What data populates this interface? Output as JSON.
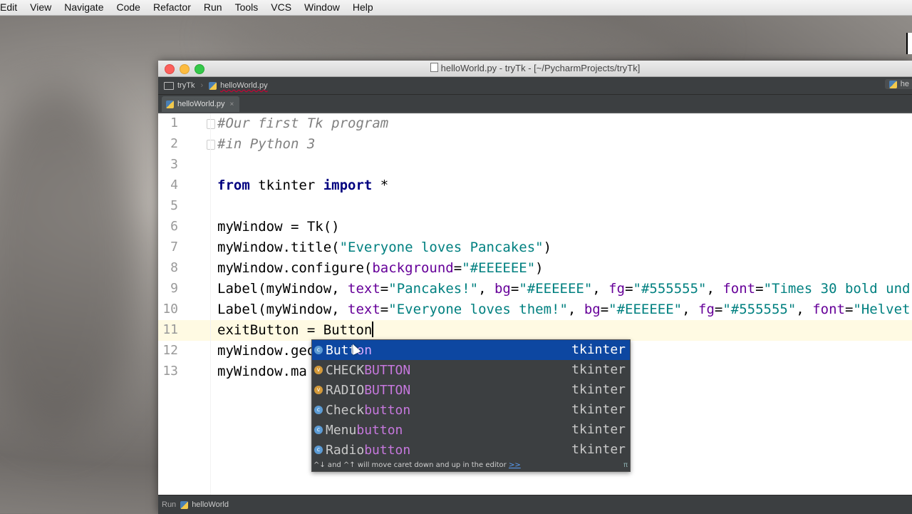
{
  "menubar": {
    "items": [
      "Edit",
      "View",
      "Navigate",
      "Code",
      "Refactor",
      "Run",
      "Tools",
      "VCS",
      "Window",
      "Help"
    ]
  },
  "window": {
    "title": "helloWorld.py - tryTk - [~/PycharmProjects/tryTk]"
  },
  "navbar": {
    "project": "tryTk",
    "file": "helloWorld.py",
    "right_label": "he"
  },
  "tabs": [
    {
      "label": "helloWorld.py",
      "close": "×"
    }
  ],
  "editor": {
    "line_numbers": [
      "1",
      "2",
      "3",
      "4",
      "5",
      "6",
      "7",
      "8",
      "9",
      "10",
      "11",
      "12",
      "13"
    ],
    "lines": {
      "l1": "#Our first Tk program",
      "l2": "#in Python 3",
      "l4_from": "from",
      "l4_mid": " tkinter ",
      "l4_import": "import",
      "l4_end": " *",
      "l6": "myWindow = Tk()",
      "l7_a": "myWindow.title(",
      "l7_s": "\"Everyone loves Pancakes\"",
      "l7_b": ")",
      "l8_a": "myWindow.configure(",
      "l8_p": "background",
      "l8_eq": "=",
      "l8_s": "\"#EEEEEE\"",
      "l8_b": ")",
      "l9_a": "Label(myWindow, ",
      "l9_p1": "text",
      "l9_s1": "\"Pancakes!\"",
      "l9_p2": "bg",
      "l9_s2": "\"#EEEEEE\"",
      "l9_p3": "fg",
      "l9_s3": "\"#555555\"",
      "l9_p4": "font",
      "l9_s4": "\"Times 30 bold und",
      "l10_a": "Label(myWindow, ",
      "l10_p1": "text",
      "l10_s1": "\"Everyone loves them!\"",
      "l10_p2": "bg",
      "l10_s2": "\"#EEEEEE\"",
      "l10_p3": "fg",
      "l10_s3": "\"#555555\"",
      "l10_p4": "font",
      "l10_s4": "\"Helvet",
      "l11": "exitButton = Button",
      "l12": "myWindow.geo",
      "l13": "myWindow.ma"
    }
  },
  "completion": {
    "items": [
      {
        "icon": "c",
        "pre": "",
        "match": "Butt",
        "post": "on",
        "source": "tkinter"
      },
      {
        "icon": "v",
        "pre": "CHECK",
        "match": "BUTTON",
        "post": "",
        "source": "tkinter"
      },
      {
        "icon": "v",
        "pre": "RADIO",
        "match": "BUTTON",
        "post": "",
        "source": "tkinter"
      },
      {
        "icon": "c",
        "pre": "Check",
        "match": "button",
        "post": "",
        "source": "tkinter"
      },
      {
        "icon": "c",
        "pre": "Menu",
        "match": "button",
        "post": "",
        "source": "tkinter"
      },
      {
        "icon": "c",
        "pre": "Radio",
        "match": "button",
        "post": "",
        "source": "tkinter"
      }
    ],
    "hint": "^↓ and ^↑ will move caret down and up in the editor",
    "hint_link": ">>",
    "pi": "π"
  },
  "runbar": {
    "label": "Run",
    "config": "helloWorld"
  }
}
